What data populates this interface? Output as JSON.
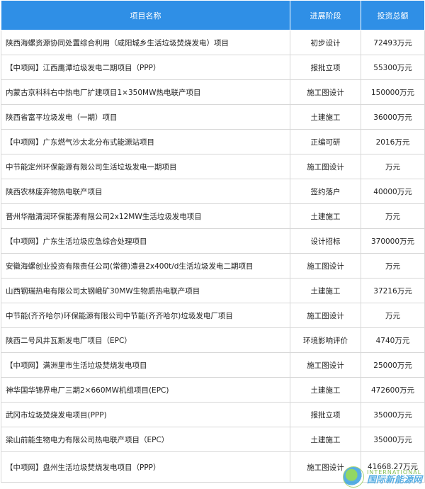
{
  "table": {
    "headers": [
      "项目名称",
      "进展阶段",
      "投资总额"
    ],
    "rows": [
      {
        "name": "陕西海螺资源协同处置综合利用（咸阳城乡生活垃圾焚烧发电）项目",
        "stage": "初步设计",
        "amount": "72493万元"
      },
      {
        "name": "【中项网】江西鹰潭垃圾发电二期项目（PPP）",
        "stage": "报批立项",
        "amount": "55300万元"
      },
      {
        "name": "内蒙古京科科右中热电厂扩建项目1×350MW热电联产项目",
        "stage": "施工图设计",
        "amount": "150000万元"
      },
      {
        "name": "陕西省富平垃圾发电（一期）项目",
        "stage": "土建施工",
        "amount": "36000万元"
      },
      {
        "name": "【中项网】广东燃气沙太北分布式能源站项目",
        "stage": "正编可研",
        "amount": "2016万元"
      },
      {
        "name": "中节能定州环保能源有限公司生活垃圾发电一期项目",
        "stage": "施工图设计",
        "amount": "万元"
      },
      {
        "name": "陕西农林废弃物热电联产项目",
        "stage": "签约落户",
        "amount": "40000万元"
      },
      {
        "name": "晋州华融清润环保能源有限公司2x12MW生活垃圾发电项目",
        "stage": "土建施工",
        "amount": "万元"
      },
      {
        "name": "【中项网】广东生活垃圾应急综合处理项目",
        "stage": "设计招标",
        "amount": "370000万元"
      },
      {
        "name": "安徽海螺创业投资有限责任公司(常德)澧县2x400t/d生活垃圾发电二期项目",
        "stage": "施工图设计",
        "amount": "万元"
      },
      {
        "name": "山西钢瑞热电有限公司太钢峨矿30MW生物质热电联产项目",
        "stage": "土建施工",
        "amount": "37216万元"
      },
      {
        "name": "中节能(齐齐哈尔)环保能源有限公司中节能(齐齐哈尔)垃圾发电厂项目",
        "stage": "施工图设计",
        "amount": "万元"
      },
      {
        "name": "陕西二号风井瓦斯发电厂项目（EPC）",
        "stage": "环境影响评价",
        "amount": "4740万元"
      },
      {
        "name": "【中项网】满洲里市生活垃圾焚烧发电项目",
        "stage": "施工图设计",
        "amount": "25000万元"
      },
      {
        "name": "神华国华锦界电厂三期2×660MW机组项目(EPC)",
        "stage": "土建施工",
        "amount": "472600万元"
      },
      {
        "name": "武冈市垃圾焚烧发电项目(PPP)",
        "stage": "报批立项",
        "amount": "35000万元"
      },
      {
        "name": "梁山前能生物电力有限公司热电联产项目（EPC）",
        "stage": "土建施工",
        "amount": "35000万元"
      },
      {
        "name": "【中项网】盘州生活垃圾焚烧发电项目（PPP）",
        "stage": "施工图设计",
        "amount": "41668.27万元"
      }
    ]
  },
  "watermark": {
    "en": "INTERNATIONAL",
    "cn": "国际新能源网"
  }
}
